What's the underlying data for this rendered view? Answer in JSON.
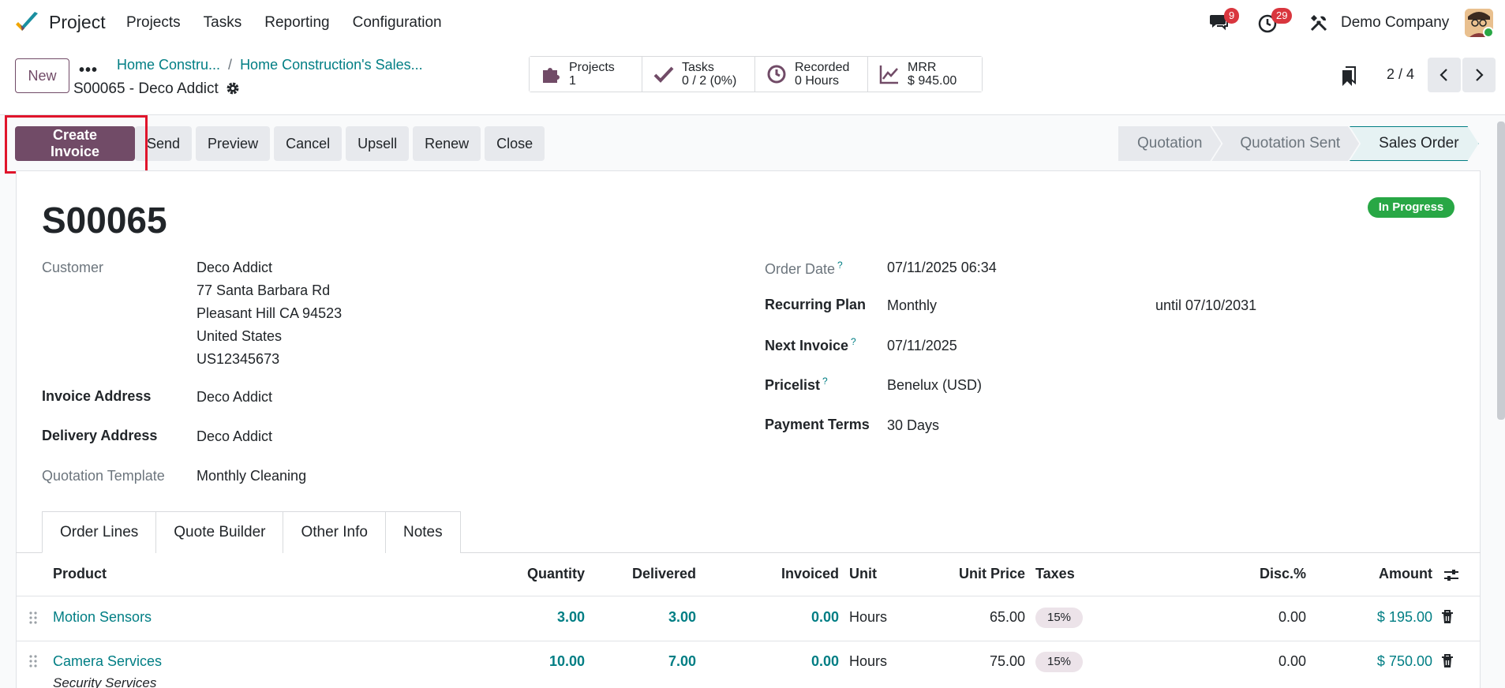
{
  "app": {
    "name": "Project"
  },
  "menu": [
    "Projects",
    "Tasks",
    "Reporting",
    "Configuration"
  ],
  "systray": {
    "messages_count": "9",
    "activity_count": "29",
    "company": "Demo Company"
  },
  "control": {
    "new_label": "New",
    "breadcrumbs": [
      "Home Constru...",
      "Home Construction's Sales..."
    ],
    "record_title": "S00065 - Deco Addict",
    "smart_buttons": [
      {
        "label": "Projects",
        "value": "1",
        "icon": "puzzle-icon"
      },
      {
        "label": "Tasks",
        "value": "0 / 2 (0%)",
        "icon": "check-icon"
      },
      {
        "label": "Recorded",
        "value": "0 Hours",
        "icon": "clock-icon"
      },
      {
        "label": "MRR",
        "value": "$ 945.00",
        "icon": "chart-line-icon"
      }
    ],
    "pager": "2 / 4"
  },
  "actions": {
    "create_invoice": "Create Invoice",
    "send": "Send",
    "preview": "Preview",
    "cancel": "Cancel",
    "upsell": "Upsell",
    "renew": "Renew",
    "close": "Close"
  },
  "stages": [
    "Quotation",
    "Quotation Sent",
    "Sales Order"
  ],
  "active_stage": "Sales Order",
  "order": {
    "name": "S00065",
    "status": "In Progress",
    "customer_label": "Customer",
    "customer_name": "Deco Addict",
    "address_lines": [
      "77 Santa Barbara Rd",
      "Pleasant Hill CA 94523",
      "United States",
      "US12345673"
    ],
    "invoice_address_label": "Invoice Address",
    "invoice_address": "Deco Addict",
    "delivery_address_label": "Delivery Address",
    "delivery_address": "Deco Addict",
    "template_label": "Quotation Template",
    "template": "Monthly Cleaning",
    "order_date_label": "Order Date",
    "order_date": "07/11/2025 06:34",
    "recurring_label": "Recurring Plan",
    "recurring_plan": "Monthly",
    "until": "until 07/10/2031",
    "next_invoice_label": "Next Invoice",
    "next_invoice": "07/11/2025",
    "pricelist_label": "Pricelist",
    "pricelist": "Benelux (USD)",
    "payment_terms_label": "Payment Terms",
    "payment_terms": "30 Days"
  },
  "tabs": [
    "Order Lines",
    "Quote Builder",
    "Other Info",
    "Notes"
  ],
  "table": {
    "headers": {
      "product": "Product",
      "quantity": "Quantity",
      "delivered": "Delivered",
      "invoiced": "Invoiced",
      "unit": "Unit",
      "unit_price": "Unit Price",
      "taxes": "Taxes",
      "disc": "Disc.%",
      "amount": "Amount"
    },
    "rows": [
      {
        "product": "Motion Sensors",
        "quantity": "3.00",
        "delivered": "3.00",
        "invoiced": "0.00",
        "unit": "Hours",
        "unit_price": "65.00",
        "tax": "15%",
        "disc": "0.00",
        "amount": "$ 195.00"
      },
      {
        "product": "Camera Services",
        "description": "Security Services",
        "quantity": "10.00",
        "delivered": "7.00",
        "invoiced": "0.00",
        "unit": "Hours",
        "unit_price": "75.00",
        "tax": "15%",
        "disc": "0.00",
        "amount": "$ 750.00"
      }
    ]
  },
  "colors": {
    "primary": "#714b67",
    "link": "#017e84",
    "success": "#28a745",
    "danger": "#d9363e",
    "highlight": "#e0142b"
  }
}
